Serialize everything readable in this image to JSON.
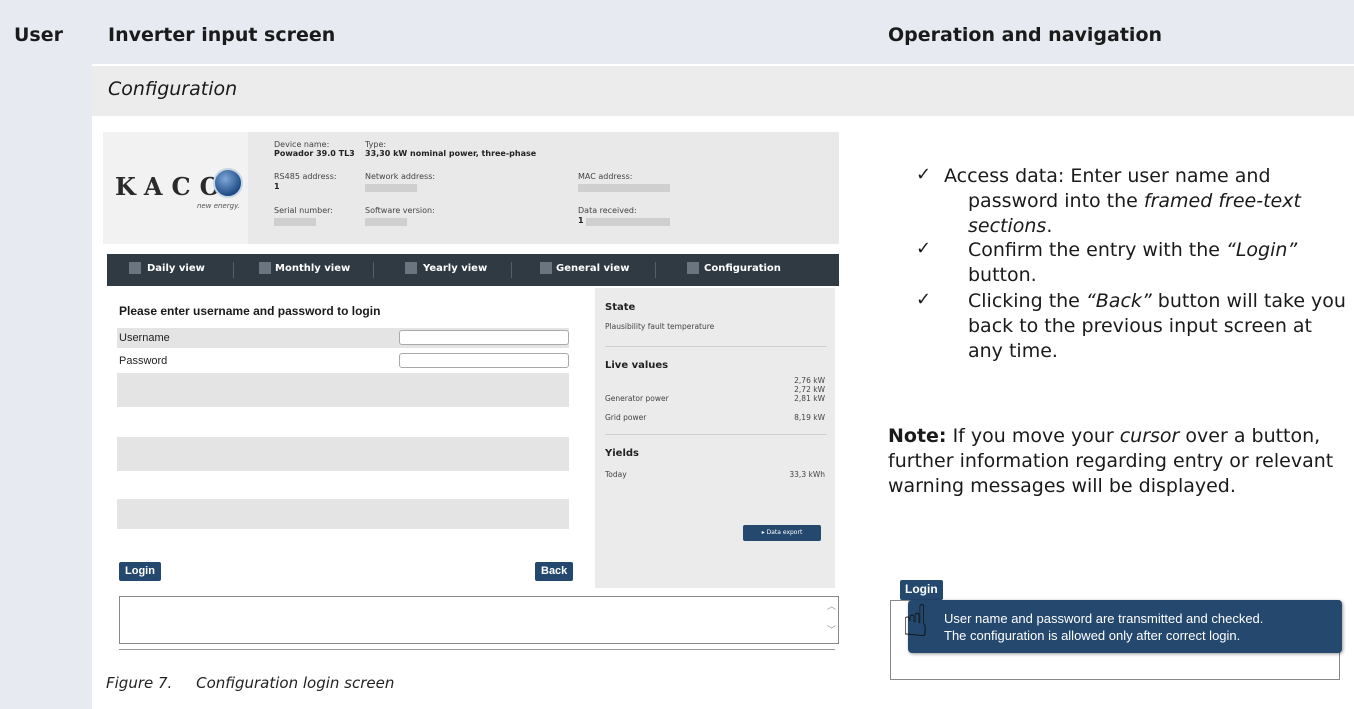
{
  "header": {
    "col_user": "User",
    "col_input": "Inverter input screen",
    "col_operation": "Operation and navigation"
  },
  "section": {
    "title": "Configuration"
  },
  "screenshot": {
    "logo_text": "KACO",
    "logo_tagline": "new energy.",
    "device_info": {
      "device_name_label": "Device name:",
      "device_name_value": "Powador 39.0 TL3",
      "type_label": "Type:",
      "type_value": "33,30 kW nominal power, three-phase",
      "rs485_label": "RS485 address:",
      "rs485_value": "1",
      "network_label": "Network address:",
      "mac_label": "MAC address:",
      "serial_label": "Serial number:",
      "software_label": "Software version:",
      "data_received_label": "Data received:",
      "data_received_value": "1"
    },
    "nav": {
      "daily": "Daily view",
      "monthly": "Monthly view",
      "yearly": "Yearly view",
      "general": "General view",
      "configuration": "Configuration"
    },
    "form": {
      "title": "Please enter username and password to login",
      "username_label": "Username",
      "password_label": "Password",
      "login_button": "Login",
      "back_button": "Back"
    },
    "sidebar": {
      "state_heading": "State",
      "state_text": "Plausibility fault temperature",
      "live_heading": "Live values",
      "generator_label": "Generator power",
      "generator_values": [
        "2,76 kW",
        "2,72 kW",
        "2,81 kW"
      ],
      "grid_label": "Grid power",
      "grid_value": "8,19 kW",
      "yields_heading": "Yields",
      "today_label": "Today",
      "today_value": "33,3 kWh",
      "export_button": "▸ Data export"
    }
  },
  "caption": "Figure 7.     Configuration login screen",
  "instructions": [
    {
      "check": "✓",
      "text_pre": " Access data:  Enter user name and password into the ",
      "text_em": "framed free-text sections",
      "text_post": "."
    },
    {
      "check": "✓",
      "text_pre": "Confirm the entry with the ",
      "text_em": "“Login”",
      "text_post": " button."
    },
    {
      "check": "✓",
      "text_pre": "Clicking the ",
      "text_em": "“Back”",
      "text_post": " button will take you back to the previous input screen at any time."
    }
  ],
  "note": {
    "label": "Note:",
    "text_pre": " If you move your ",
    "text_em": "cursor",
    "text_post": " over a button, further information regarding entry or relevant warning messages will be displayed."
  },
  "demo": {
    "login_button": "Login",
    "tooltip_line1": "User name and password are transmitted and checked.",
    "tooltip_line2": "The configuration is allowed only after correct login."
  }
}
